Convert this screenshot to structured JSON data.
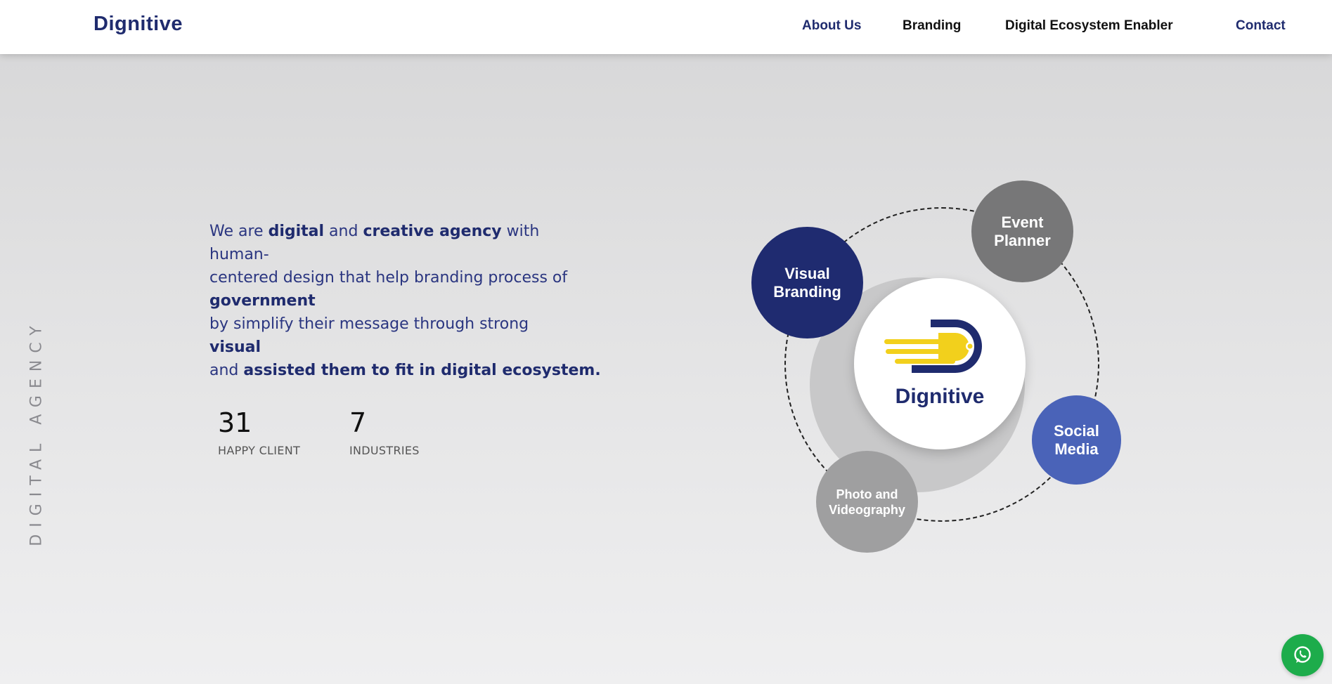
{
  "header": {
    "brand": "Dignitive",
    "nav": [
      {
        "label": "About Us",
        "color": "#1f2b6e"
      },
      {
        "label": "Branding",
        "color": "#111111"
      },
      {
        "label": "Digital Ecosystem Enabler",
        "color": "#111111"
      },
      {
        "label": "Contact",
        "color": "#1f2b6e"
      }
    ]
  },
  "side_label": "DIGITAL AGENCY",
  "intro": {
    "l1a": "We are ",
    "l1b": "digital",
    "l1c": " and ",
    "l1d": "creative agency",
    "l1e": " with human-",
    "l2": "centered design that help branding process of",
    "l3": "government",
    "l4": "by simplify their message through strong",
    "l5": "visual",
    "l6a": "and ",
    "l6b": "assisted them to fit in digital ecosystem."
  },
  "stats": [
    {
      "value": "31",
      "label": "HAPPY CLIENT"
    },
    {
      "value": "7",
      "label": "INDUSTRIES"
    }
  ],
  "diagram": {
    "center_label": "Dignitive",
    "services": [
      {
        "line1": "Visual",
        "line2": "Branding",
        "color": "#1f2b70"
      },
      {
        "line1": "Event",
        "line2": "Planner",
        "color": "#777778"
      },
      {
        "line1": "Social",
        "line2": "Media",
        "color": "#4a63b8"
      },
      {
        "line1": "Photo and",
        "line2": "Videography",
        "color": "#9f9fa0"
      }
    ]
  },
  "colors": {
    "brand_navy": "#1f2b6e",
    "brand_yellow": "#f2d01c",
    "whatsapp_green": "#1dac4b"
  },
  "icons": {
    "logo": "dignitive-logo-icon",
    "chat": "whatsapp-icon"
  }
}
